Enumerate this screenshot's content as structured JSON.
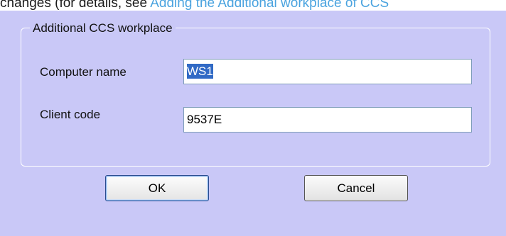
{
  "document": {
    "text_before_link": "changes (for details, see ",
    "link_text": "Adding the Additional workplace of CCS"
  },
  "dialog": {
    "group_title": "Additional CCS workplace",
    "computer_name": {
      "label": "Computer name",
      "value": "WS1"
    },
    "client_code": {
      "label": "Client code",
      "value": "9537E"
    },
    "ok_label": "OK",
    "cancel_label": "Cancel"
  },
  "colors": {
    "dialog_background": "#c9c8f7",
    "selection": "#316ac5",
    "link": "#4aa3df"
  }
}
